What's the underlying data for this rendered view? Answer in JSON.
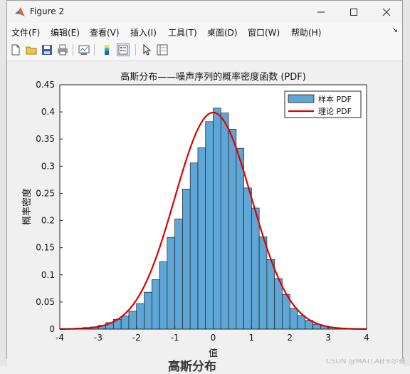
{
  "window": {
    "title": "Figure 2",
    "minimize_label": "minimize",
    "maximize_label": "maximize",
    "close_label": "close"
  },
  "menu": [
    "文件(F)",
    "编辑(E)",
    "查看(V)",
    "插入(I)",
    "工具(T)",
    "桌面(D)",
    "窗口(W)",
    "帮助(H)"
  ],
  "toolbar": [
    "new-figure-icon",
    "open-file-icon",
    "save-icon",
    "print-icon",
    "link-plot-icon",
    "colorbar-icon",
    "legend-icon",
    "pointer-icon",
    "property-inspector-icon"
  ],
  "background": {
    "bottom_text": "高斯分布",
    "watermark": "CSDN @MATLAB卡尔曼"
  },
  "chart_data": {
    "type": "bar",
    "title": "高斯分布——噪声序列的概率密度函数 (PDF)",
    "xlabel": "值",
    "ylabel": "概率密度",
    "xlim": [
      -4,
      4
    ],
    "ylim": [
      0,
      0.45
    ],
    "xticks": [
      -4,
      -3,
      -2,
      -1,
      0,
      1,
      2,
      3,
      4
    ],
    "yticks": [
      0,
      0.05,
      0.1,
      0.15,
      0.2,
      0.25,
      0.3,
      0.35,
      0.4,
      0.45
    ],
    "bin_width": 0.2,
    "bin_edges_start": -4.0,
    "bar_color": "#5ea6d6",
    "values": [
      0.001,
      0.001,
      0.002,
      0.003,
      0.004,
      0.007,
      0.012,
      0.018,
      0.024,
      0.033,
      0.047,
      0.068,
      0.091,
      0.124,
      0.169,
      0.203,
      0.258,
      0.306,
      0.334,
      0.382,
      0.407,
      0.398,
      0.368,
      0.333,
      0.26,
      0.223,
      0.17,
      0.128,
      0.093,
      0.064,
      0.038,
      0.025,
      0.016,
      0.009,
      0.006,
      0.003,
      0.002,
      0.001,
      0.001,
      0.001
    ],
    "series": [
      {
        "name": "样本 PDF",
        "kind": "histogram",
        "color": "#5ea6d6"
      },
      {
        "name": "理论 PDF",
        "kind": "line",
        "color": "#e00000",
        "distribution": "normal",
        "mean": 0,
        "std": 1
      }
    ],
    "legend": "top-right",
    "grid": false
  }
}
